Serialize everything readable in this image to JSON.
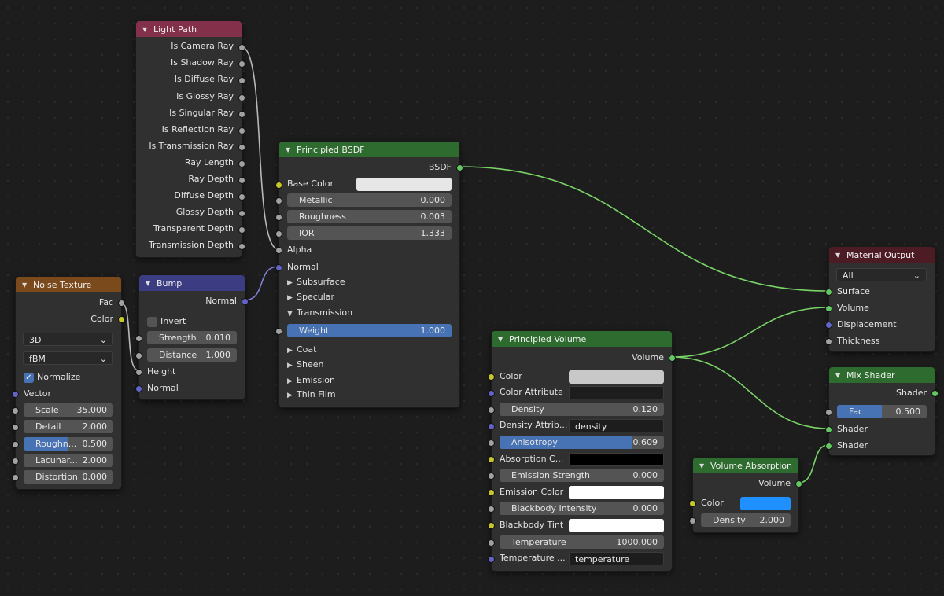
{
  "colors": {
    "header_input": "#83314a",
    "header_shader": "#2e6b2e",
    "header_texture": "#7a4a1c",
    "header_vector": "#3c3c83",
    "header_output": "#4d1b24",
    "socket_float": "#a1a1a1",
    "socket_color": "#c7c729",
    "socket_shader": "#63c763",
    "socket_vector": "#6363c7",
    "wire": "#7ad467"
  },
  "light_path": {
    "title": "Light Path",
    "outputs": [
      "Is Camera Ray",
      "Is Shadow Ray",
      "Is Diffuse Ray",
      "Is Glossy Ray",
      "Is Singular Ray",
      "Is Reflection Ray",
      "Is Transmission Ray",
      "Ray Length",
      "Ray Depth",
      "Diffuse Depth",
      "Glossy Depth",
      "Transparent Depth",
      "Transmission Depth"
    ]
  },
  "principled_bsdf": {
    "title": "Principled BSDF",
    "output": "BSDF",
    "base_color_label": "Base Color",
    "base_color": "#e6e6e6",
    "metallic_label": "Metallic",
    "metallic": "0.000",
    "roughness_label": "Roughness",
    "roughness": "0.003",
    "ior_label": "IOR",
    "ior": "1.333",
    "alpha_label": "Alpha",
    "normal_label": "Normal",
    "subsurface": "Subsurface",
    "specular": "Specular",
    "transmission": "Transmission",
    "weight_label": "Weight",
    "weight": "1.000",
    "coat": "Coat",
    "sheen": "Sheen",
    "emission": "Emission",
    "thin_film": "Thin Film"
  },
  "noise_texture": {
    "title": "Noise Texture",
    "out_fac": "Fac",
    "out_color": "Color",
    "dimensions": "3D",
    "type": "fBM",
    "normalize_label": "Normalize",
    "normalize": true,
    "vector": "Vector",
    "scale_label": "Scale",
    "scale": "35.000",
    "detail_label": "Detail",
    "detail": "2.000",
    "roughness_label": "Roughn...",
    "roughness": "0.500",
    "lacunarity_label": "Lacunar...",
    "lacunarity": "2.000",
    "distortion_label": "Distortion",
    "distortion": "0.000"
  },
  "bump": {
    "title": "Bump",
    "output": "Normal",
    "invert_label": "Invert",
    "strength_label": "Strength",
    "strength": "0.010",
    "distance_label": "Distance",
    "distance": "1.000",
    "height": "Height",
    "normal": "Normal"
  },
  "principled_volume": {
    "title": "Principled Volume",
    "output": "Volume",
    "color_label": "Color",
    "color": "#c8c8c8",
    "color_attr_label": "Color Attribute",
    "color_attr": "",
    "density_label": "Density",
    "density": "0.120",
    "density_attr_label": "Density Attrib...",
    "density_attr": "density",
    "anisotropy_label": "Anisotropy",
    "anisotropy": "0.609",
    "absorption_label": "Absorption C...",
    "absorption_color": "#000000",
    "emission_strength_label": "Emission Strength",
    "emission_strength": "0.000",
    "emission_color_label": "Emission Color",
    "emission_color": "#ffffff",
    "blackbody_label": "Blackbody Intensity",
    "blackbody": "0.000",
    "blackbody_tint_label": "Blackbody Tint",
    "blackbody_tint": "#ffffff",
    "temperature_label": "Temperature",
    "temperature": "1000.000",
    "temperature_attr_label": "Temperature ...",
    "temperature_attr": "temperature"
  },
  "volume_absorption": {
    "title": "Volume Absorption",
    "output": "Volume",
    "color_label": "Color",
    "color": "#1e90ff",
    "density_label": "Density",
    "density": "2.000"
  },
  "material_output": {
    "title": "Material Output",
    "target": "All",
    "surface": "Surface",
    "volume": "Volume",
    "displacement": "Displacement",
    "thickness": "Thickness"
  },
  "mix_shader": {
    "title": "Mix Shader",
    "output": "Shader",
    "fac_label": "Fac",
    "fac": "0.500",
    "shader1": "Shader",
    "shader2": "Shader"
  }
}
